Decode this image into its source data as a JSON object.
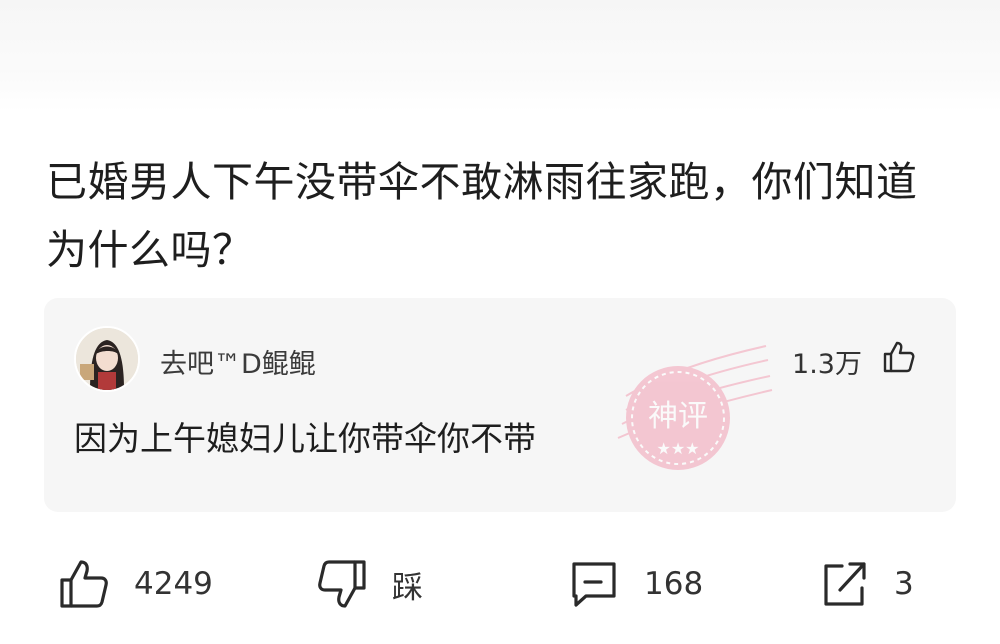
{
  "post": {
    "title": "已婚男人下午没带伞不敢淋雨往家跑，你们知道为什么吗？"
  },
  "comment": {
    "username": "去吧™D鲲鲲",
    "likes": "1.3万",
    "text": "因为上午媳妇儿让你带伞你不带",
    "badge_text": "神评"
  },
  "actions": {
    "like_count": "4249",
    "dislike_label": "踩",
    "comment_count": "168",
    "share_count": "3"
  },
  "colors": {
    "card_bg": "#f6f6f6",
    "stamp_pink": "#f2a0b4",
    "icon": "#2a2a2a"
  }
}
